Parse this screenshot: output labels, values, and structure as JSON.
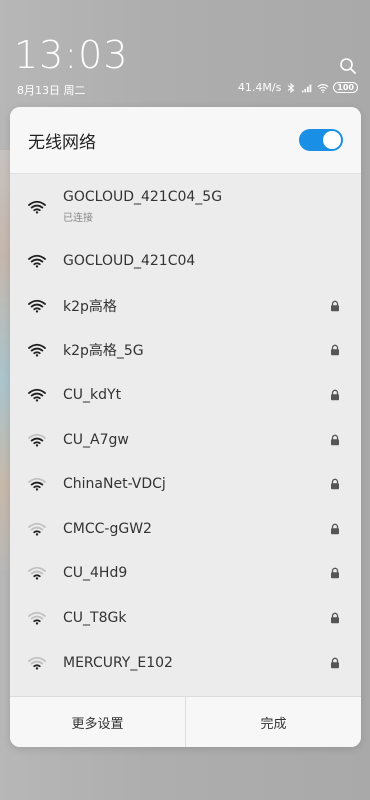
{
  "status_bar": {
    "time": "13:03",
    "date": "8月13日 周二",
    "speed": "41.4M/s",
    "battery": "100"
  },
  "dialog": {
    "title": "无线网络",
    "wifi_enabled": true,
    "networks": [
      {
        "name": "GOCLOUD_421C04_5G",
        "status": "已连接",
        "locked": false,
        "signal": "full"
      },
      {
        "name": "GOCLOUD_421C04",
        "locked": false,
        "signal": "full"
      },
      {
        "name": "k2p高格",
        "locked": true,
        "signal": "full"
      },
      {
        "name": "k2p高格_5G",
        "locked": true,
        "signal": "full"
      },
      {
        "name": "CU_kdYt",
        "locked": true,
        "signal": "full"
      },
      {
        "name": "CU_A7gw",
        "locked": true,
        "signal": "medium"
      },
      {
        "name": "ChinaNet-VDCj",
        "locked": true,
        "signal": "medium"
      },
      {
        "name": "CMCC-gGW2",
        "locked": true,
        "signal": "weak"
      },
      {
        "name": "CU_4Hd9",
        "locked": true,
        "signal": "weak"
      },
      {
        "name": "CU_T8Gk",
        "locked": true,
        "signal": "weak"
      },
      {
        "name": "MERCURY_E102",
        "locked": true,
        "signal": "weak"
      }
    ],
    "more_settings_label": "更多设置",
    "done_label": "完成"
  },
  "colors": {
    "toggle_on": "#1a8fe6"
  }
}
